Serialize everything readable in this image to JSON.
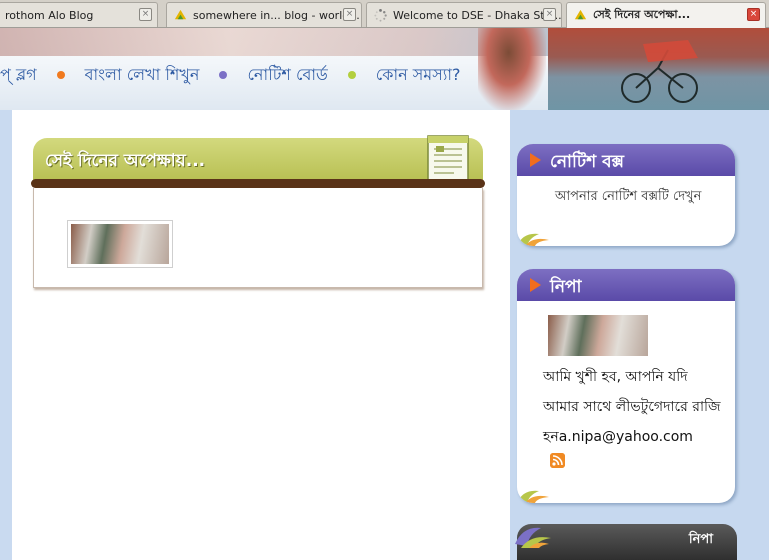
{
  "tabs": [
    {
      "title": "rothom Alo Blog",
      "active": false
    },
    {
      "title": "somewhere in... blog - world...",
      "active": false
    },
    {
      "title": "Welcome to DSE - Dhaka Sto...",
      "active": false
    },
    {
      "title": "সেই দিনের অপেক্ষা...",
      "active": true
    }
  ],
  "tab_close_glyph": "×",
  "nav": {
    "items": [
      "প্‌ ব্লগ",
      "বাংলা লেখা শিখুন",
      "নোটিশ বোর্ড",
      "কোন সমস্যা?"
    ],
    "dot_colors": [
      "#f07a1f",
      "#7b70c6",
      "#b3cf3e"
    ]
  },
  "post": {
    "title": "সেই দিনের অপেক্ষায়..."
  },
  "notice_widget": {
    "title": "নোটিশ বক্স",
    "text": "আপনার নোটিশ বক্সটি দেখুন"
  },
  "profile_widget": {
    "title": "নিপা",
    "lines": [
      "আমি খুশী হব, আপনি যদি",
      "আমার সাথে লীভটুগেদারে রাজি",
      "হনa.nipa@yahoo.com"
    ]
  },
  "bottom_widget": {
    "title": "নিপা"
  },
  "colors": {
    "nav_text": "#2d5aa3",
    "panel_header": "#b7bf52",
    "widget_header": "#5a4aa8",
    "arrow": "#f16d1e"
  }
}
